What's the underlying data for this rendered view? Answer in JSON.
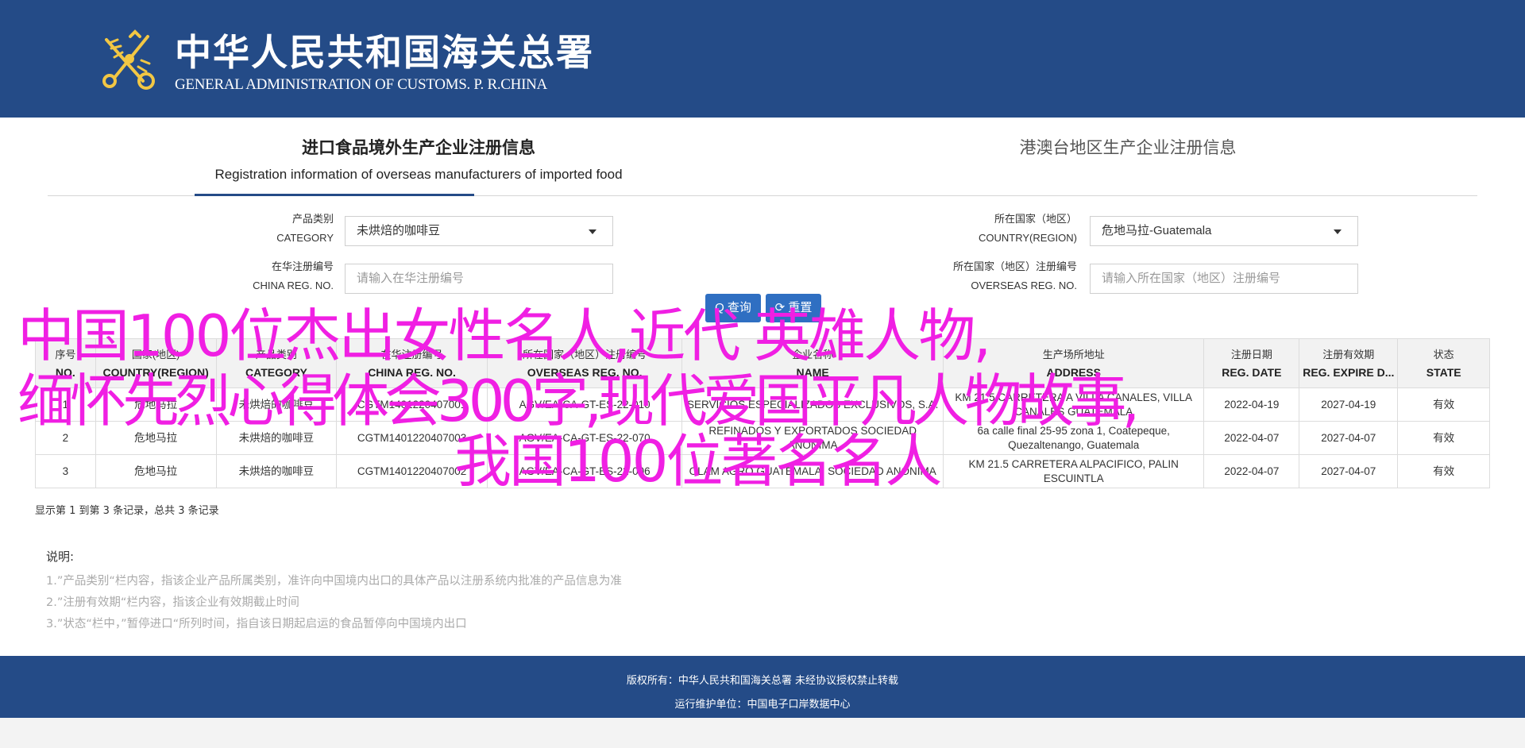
{
  "header": {
    "title_cn": "中华人民共和国海关总署",
    "title_en": "GENERAL ADMINISTRATION OF CUSTOMS. P. R.CHINA",
    "emblem_icon": "customs-key-emblem-icon",
    "bg_color": "#244b87"
  },
  "tabs": [
    {
      "title_cn": "进口食品境外生产企业注册信息",
      "title_en": "Registration information of overseas manufacturers of imported food",
      "active": true
    },
    {
      "title_cn": "港澳台地区生产企业注册信息",
      "active": false
    }
  ],
  "form": {
    "category": {
      "label_cn": "产品类别",
      "label_en": "CATEGORY",
      "value": "未烘焙的咖啡豆"
    },
    "country": {
      "label_cn": "所在国家（地区）",
      "label_en": "COUNTRY(REGION)",
      "value": "危地马拉-Guatemala"
    },
    "china_reg": {
      "label_cn": "在华注册编号",
      "label_en": "CHINA REG. NO.",
      "placeholder": "请输入在华注册编号"
    },
    "overseas_reg": {
      "label_cn": "所在国家（地区）注册编号",
      "label_en": "OVERSEAS REG. NO.",
      "placeholder": "请输入所在国家（地区）注册编号"
    },
    "search_label": "Q 查询",
    "reset_label": "⟳ 重置"
  },
  "table": {
    "headers": [
      {
        "cn": "序号",
        "en": "NO."
      },
      {
        "cn": "国家(地区)",
        "en": "COUNTRY(REGION)"
      },
      {
        "cn": "产品类别",
        "en": "CATEGORY"
      },
      {
        "cn": "在华注册编号",
        "en": "CHINA REG. NO."
      },
      {
        "cn": "所在国家（地区）注册编号",
        "en": "OVERSEAS REG. NO."
      },
      {
        "cn": "企业名称",
        "en": "NAME"
      },
      {
        "cn": "生产场所地址",
        "en": "ADDRESS"
      },
      {
        "cn": "注册日期",
        "en": "REG. DATE"
      },
      {
        "cn": "注册有效期",
        "en": "REG. EXPIRE D..."
      },
      {
        "cn": "状态",
        "en": "STATE"
      }
    ],
    "rows": [
      [
        "1",
        "危地马拉",
        "未烘焙的咖啡豆",
        "CGTM1401220407001",
        "AGV/EA-CA-GT-ES-22-010",
        "SERVICIOS ESPECIALIZADOS EXCLUSIVOS, S.A.",
        "KM 21.5 CARRETERA A VILLA CANALES, VILLA CANALES GUATEMALA",
        "2022-04-19",
        "2027-04-19",
        "有效"
      ],
      [
        "2",
        "危地马拉",
        "未烘焙的咖啡豆",
        "CGTM1401220407003",
        "AGV/EA-CA-GT-ES-22-070",
        "REFINADOS Y EXPORTADOS SOCIEDAD ANONIMA",
        "6a calle final 25-95 zona 1, Coatepeque, Quezaltenango, Guatemala",
        "2022-04-07",
        "2027-04-07",
        "有效"
      ],
      [
        "3",
        "危地马拉",
        "未烘焙的咖啡豆",
        "CGTM1401220407002",
        "AGV/EA-CA-GT-ES-22-006",
        "OLAM AGRO GUATEMALA, SOCIEDAD ANONIMA",
        "KM 21.5 CARRETERA ALPACIFICO, PALIN ESCUINTLA",
        "2022-04-07",
        "2027-04-07",
        "有效"
      ]
    ]
  },
  "pager": "显示第 1 到第 3 条记录，总共 3 条记录",
  "notes": {
    "title": "说明:",
    "items": [
      "1.”产品类别“栏内容，指该企业产品所属类别，准许向中国境内出口的具体产品以注册系统内批准的产品信息为准",
      "2.”注册有效期“栏内容，指该企业有效期截止时间",
      "3.”状态“栏中，”暂停进口“所列时间，指自该日期起启运的食品暂停向中国境内出口"
    ]
  },
  "footer": {
    "copyright": "版权所有：中华人民共和国海关总署 未经协议授权禁止转载",
    "operator": "运行维护单位：中国电子口岸数据中心"
  },
  "overlay": {
    "line1": "中国100位杰出女性名人,近代   英雄人物,",
    "line2": "缅怀先烈心得体会300字,现代爱国平凡人物故事,",
    "line3": "我国100位著名名人",
    "color": "#f01fe3"
  }
}
